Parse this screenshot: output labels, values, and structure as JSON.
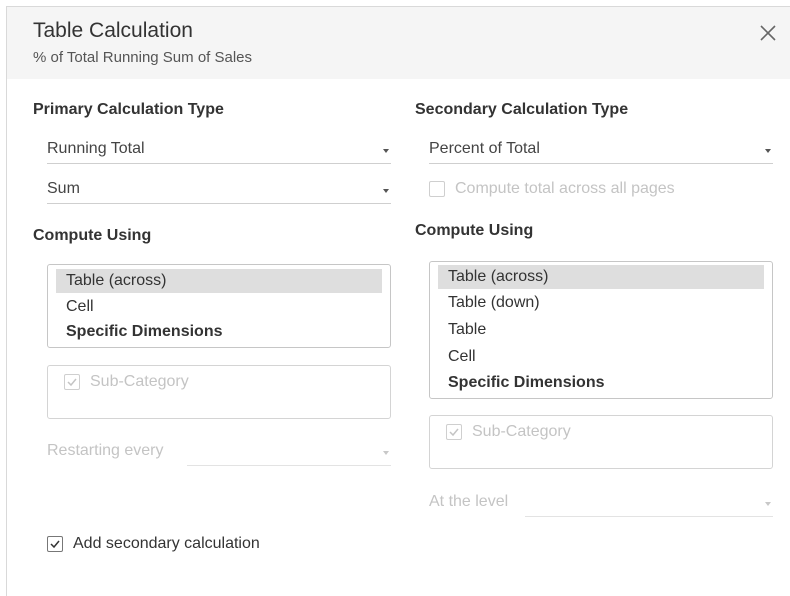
{
  "dialog": {
    "title": "Table Calculation",
    "subtitle": "% of Total Running Sum of Sales",
    "close_icon": "close-icon"
  },
  "primary": {
    "heading": "Primary Calculation Type",
    "calc_type": "Running Total",
    "aggregation": "Sum",
    "compute_heading": "Compute Using",
    "compute_options": [
      "Table (across)",
      "Cell",
      "Specific Dimensions"
    ],
    "selected_option": "Table (across)",
    "dimension": "Sub-Category",
    "restart_label": "Restarting every",
    "restart_value": ""
  },
  "secondary": {
    "heading": "Secondary Calculation Type",
    "calc_type": "Percent of Total",
    "compute_total_label": "Compute total across all pages",
    "compute_heading": "Compute Using",
    "compute_options": [
      "Table (across)",
      "Table (down)",
      "Table",
      "Cell",
      "Specific Dimensions"
    ],
    "selected_option": "Table (across)",
    "dimension": "Sub-Category",
    "level_label": "At the level",
    "level_value": ""
  },
  "add_secondary": {
    "label": "Add secondary calculation",
    "checked": true
  },
  "colors": {
    "header_bg": "#f5f5f5",
    "selected_bg": "#dedede",
    "disabled_text": "#c4c4c4"
  }
}
